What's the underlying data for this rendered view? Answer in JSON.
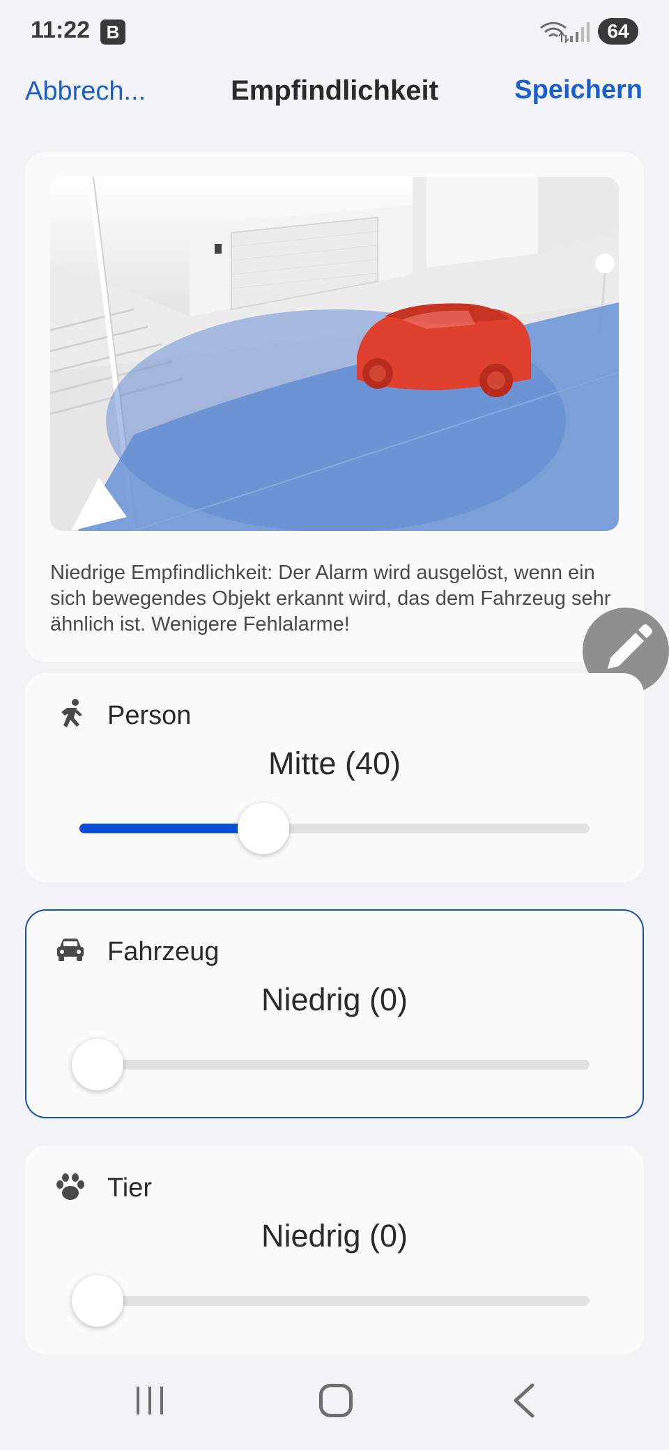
{
  "status_bar": {
    "time": "11:22",
    "badge": "B",
    "battery": "64"
  },
  "header": {
    "cancel_label": "Abbrech...",
    "title": "Empfindlichkeit",
    "save_label": "Speichern"
  },
  "preview": {
    "description": "Niedrige Empfindlichkeit: Der Alarm wird ausgelöst, wenn ein sich bewegendes Objekt erkannt wird, das dem Fahrzeug sehr ähnlich ist. Wenigere Fehlalarme!"
  },
  "categories": [
    {
      "icon": "running-person-icon",
      "label": "Person",
      "value_text": "Mitte (40)",
      "level": 0.4
    },
    {
      "icon": "car-icon",
      "label": "Fahrzeug",
      "value_text": "Niedrig (0)",
      "level": 0.0,
      "selected": true
    },
    {
      "icon": "paw-icon",
      "label": "Tier",
      "value_text": "Niedrig (0)",
      "level": 0.0
    }
  ],
  "colors": {
    "accent": "#1a5fd0",
    "slider_fill": "#0a4fd6",
    "selected_border": "#1a4fb5",
    "detection_zone": "#6f97d6",
    "vehicle": "#e0402e"
  }
}
